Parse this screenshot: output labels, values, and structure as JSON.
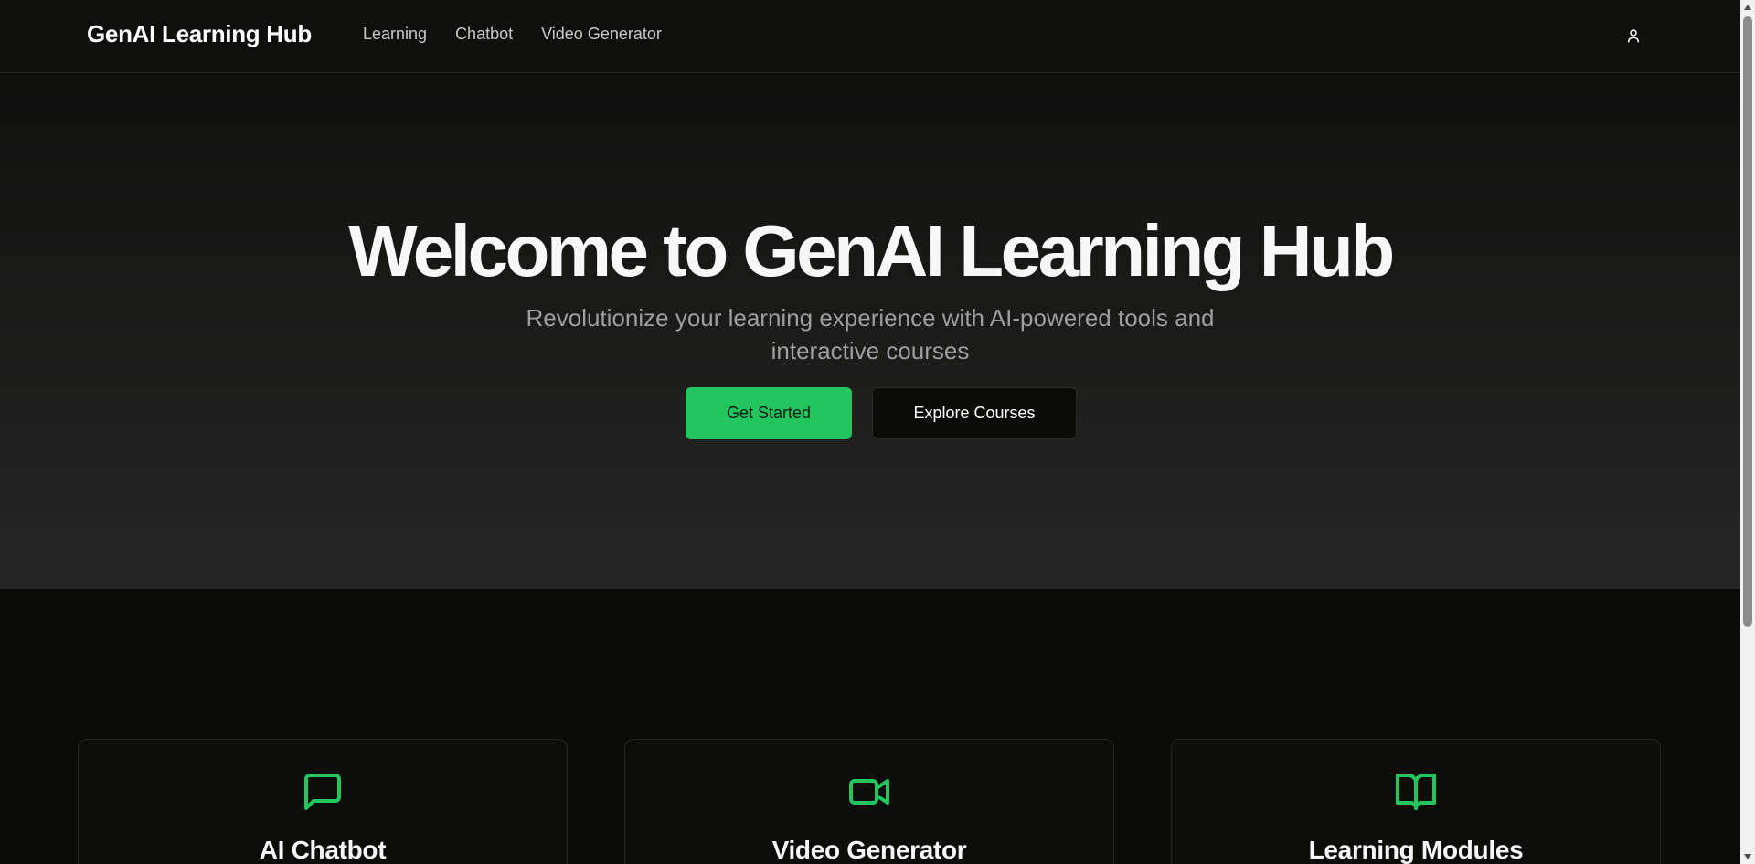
{
  "header": {
    "brand": "GenAI Learning Hub",
    "nav": [
      {
        "label": "Learning"
      },
      {
        "label": "Chatbot"
      },
      {
        "label": "Video Generator"
      }
    ],
    "user_icon": "user-icon"
  },
  "hero": {
    "title": "Welcome to GenAI Learning Hub",
    "subtitle": "Revolutionize your learning experience with AI-powered tools and interactive courses",
    "primary_button": "Get Started",
    "secondary_button": "Explore Courses"
  },
  "features": [
    {
      "title": "AI Chatbot",
      "icon": "message-square-icon"
    },
    {
      "title": "Video Generator",
      "icon": "video-icon"
    },
    {
      "title": "Learning Modules",
      "icon": "book-open-icon"
    }
  ],
  "colors": {
    "accent": "#22c55e",
    "background": "#0b0b0a",
    "hero_gradient_end": "#262626"
  }
}
